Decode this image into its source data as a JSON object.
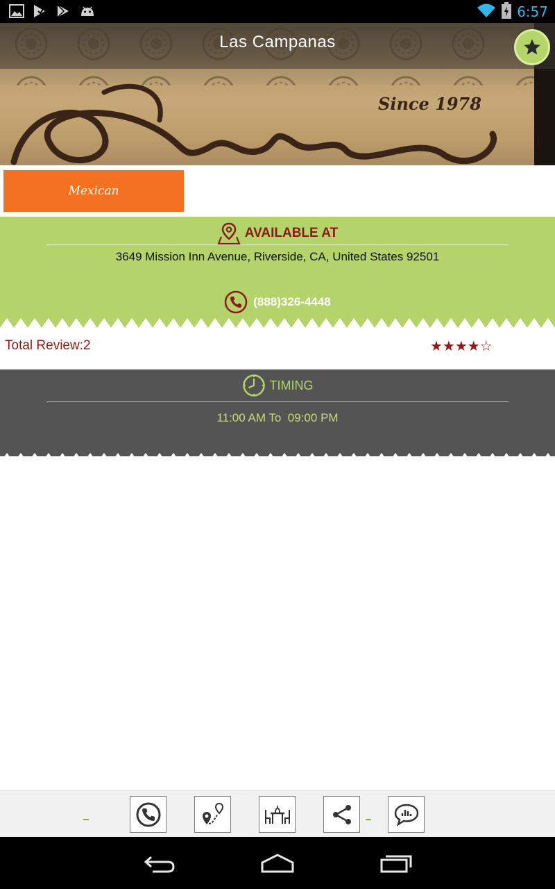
{
  "status_bar": {
    "time": "6:57",
    "left_icons": [
      "gallery-icon",
      "play-store-check-icon",
      "play-store-icon",
      "android-icon"
    ],
    "right_icons": [
      "wifi-icon",
      "battery-charging-icon"
    ]
  },
  "header": {
    "title": "Las Campanas",
    "favorite_icon": "star-icon"
  },
  "category": {
    "label": "Mexican",
    "color": "#f47121"
  },
  "availability": {
    "title": "AVAILABLE AT",
    "address": "3649 Mission Inn Avenue, Riverside, CA, United States 92501",
    "phone": "(888)326-4448",
    "background": "#b4d36a"
  },
  "reviews": {
    "label": "Total Review:2",
    "rating": 4,
    "max_rating": 5,
    "stars_text": "★★★★☆"
  },
  "timing": {
    "title": "TIMING",
    "hours": "11:00 AM To  09:00 PM",
    "background": "#545454"
  },
  "actions": [
    {
      "name": "call-action-button",
      "icon": "phone-icon"
    },
    {
      "name": "directions-action-button",
      "icon": "map-route-icon"
    },
    {
      "name": "reserve-table-action-button",
      "icon": "dining-table-icon"
    },
    {
      "name": "share-action-button",
      "icon": "share-icon"
    },
    {
      "name": "reviews-action-button",
      "icon": "comment-chart-icon"
    }
  ],
  "nav": [
    "back-icon",
    "home-icon",
    "recent-apps-icon"
  ]
}
